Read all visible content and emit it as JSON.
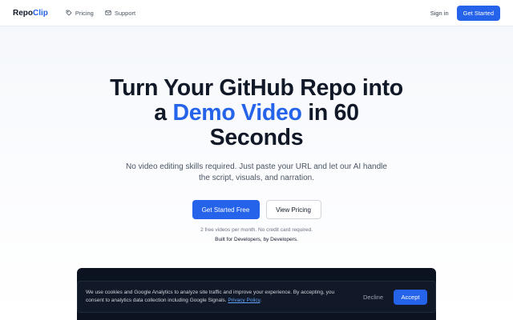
{
  "header": {
    "brand_main": "Repo",
    "brand_accent": "Clip",
    "nav": [
      {
        "label": "Pricing",
        "icon": "tag-icon"
      },
      {
        "label": "Support",
        "icon": "mail-icon"
      }
    ],
    "signin_label": "Sign in",
    "get_started_label": "Get Started"
  },
  "hero": {
    "headline_line1": "Turn Your GitHub Repo into",
    "headline_pre": "a ",
    "headline_highlight": "Demo Video",
    "headline_post": " in 60",
    "headline_line3": "Seconds",
    "subtitle": "No video editing skills required. Just paste your URL and let our AI handle the script, visuals, and narration.",
    "primary_cta": "Get Started Free",
    "secondary_cta": "View Pricing",
    "note": "2 free videos per month. No credit card required.",
    "tagline": "Built for Developers, by Developers."
  },
  "cookie": {
    "text": "We use cookies and Google Analytics to analyze site traffic and improve your experience. By accepting, you consent to analytics data collection including Google Signals. ",
    "link": "Privacy Policy",
    "text_end": ".",
    "decline_label": "Decline",
    "accept_label": "Accept"
  },
  "colors": {
    "accent": "#2563eb",
    "text": "#111827",
    "banner_bg": "#111827"
  }
}
